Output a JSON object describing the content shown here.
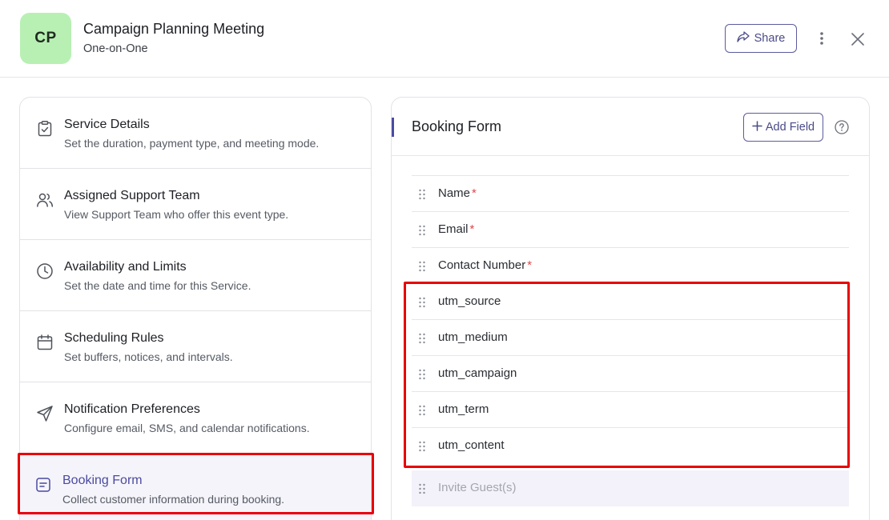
{
  "header": {
    "avatar_initials": "CP",
    "title": "Campaign Planning Meeting",
    "subtitle": "One-on-One",
    "share_label": "Share",
    "share_icon": "share-forward-icon",
    "more_icon": "kebab-menu-icon",
    "close_icon": "close-icon"
  },
  "steps": [
    {
      "title": "Service Details",
      "description": "Set the duration, payment type, and meeting mode.",
      "icon": "clipboard-check-icon"
    },
    {
      "title": "Assigned Support Team",
      "description": "View Support Team who offer this event type.",
      "icon": "users-icon"
    },
    {
      "title": "Availability and Limits",
      "description": "Set the date and time for this Service.",
      "icon": "clock-icon"
    },
    {
      "title": "Scheduling Rules",
      "description": "Set buffers, notices, and intervals.",
      "icon": "calendar-icon"
    },
    {
      "title": "Notification Preferences",
      "description": "Configure email, SMS, and calendar notifications.",
      "icon": "send-icon"
    },
    {
      "title": "Booking Form",
      "description": "Collect customer information during booking.",
      "icon": "form-icon",
      "active": true
    }
  ],
  "booking_form": {
    "title": "Booking Form",
    "add_field_label": "Add Field",
    "add_field_icon": "plus-icon",
    "help_icon": "help-circle-icon",
    "fields": [
      {
        "label": "Name",
        "required": "*"
      },
      {
        "label": "Email",
        "required": "*"
      },
      {
        "label": "Contact Number",
        "required": "*"
      },
      {
        "label": "utm_source",
        "required": ""
      },
      {
        "label": "utm_medium",
        "required": ""
      },
      {
        "label": "utm_campaign",
        "required": ""
      },
      {
        "label": "utm_term",
        "required": ""
      },
      {
        "label": "utm_content",
        "required": ""
      },
      {
        "label": "Invite Guest(s)",
        "required": "",
        "disabled": true
      }
    ]
  },
  "colors": {
    "accent": "#4b4ba5",
    "avatar_bg": "#b8f0b4",
    "highlight": "#e8000b",
    "required": "#e0474c"
  }
}
